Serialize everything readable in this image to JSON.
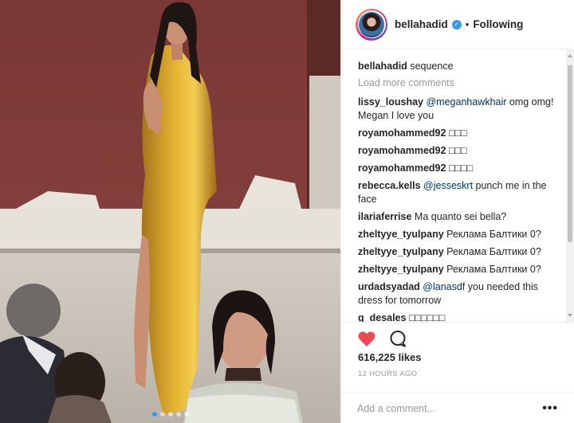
{
  "post": {
    "image_alt": "",
    "carousel": {
      "count": 5,
      "active": 1
    }
  },
  "header": {
    "username": "bellahadid",
    "separator": "•",
    "follow_label": "Following",
    "verified_icon": "verified-badge-icon"
  },
  "caption": {
    "username": "bellahadid",
    "text": "sequence"
  },
  "load_more": "Load more comments",
  "comments": [
    {
      "user": "lissy_loushay",
      "mention": "@meganhawkhair",
      "text": " omg omg! Megan I love you"
    },
    {
      "user": "royamohammed92",
      "mention": "",
      "text": "□□□"
    },
    {
      "user": "royamohammed92",
      "mention": "",
      "text": "□□□"
    },
    {
      "user": "royamohammed92",
      "mention": "",
      "text": "□□□□"
    },
    {
      "user": "rebecca.kells",
      "mention": "@jesseskrt",
      "text": " punch me in the face"
    },
    {
      "user": "ilariaferrise",
      "mention": "",
      "text": "Ma quanto sei bella?"
    },
    {
      "user": "zheltyye_tyulpany",
      "mention": "",
      "text": "Реклама Балтики 0?"
    },
    {
      "user": "zheltyye_tyulpany",
      "mention": "",
      "text": "Реклама Балтики 0?"
    },
    {
      "user": "zheltyye_tyulpany",
      "mention": "",
      "text": "Реклама Балтики 0?"
    },
    {
      "user": "urdadsyadad",
      "mention": "@lanasdf",
      "text": " you needed this dress for tomorrow"
    },
    {
      "user": "g_desales",
      "mention": "",
      "text": "□□□□□□"
    }
  ],
  "actions": {
    "like_icon": "heart-icon",
    "comment_icon": "comment-icon",
    "like_color": "#ed4956"
  },
  "likes": "616,225 likes",
  "timestamp": "12 HOURS AGO",
  "add_comment": {
    "placeholder": "Add a comment...",
    "more_label": "•••"
  },
  "colors": {
    "accent": "#3897f0",
    "text": "#262626",
    "muted": "#999999"
  }
}
